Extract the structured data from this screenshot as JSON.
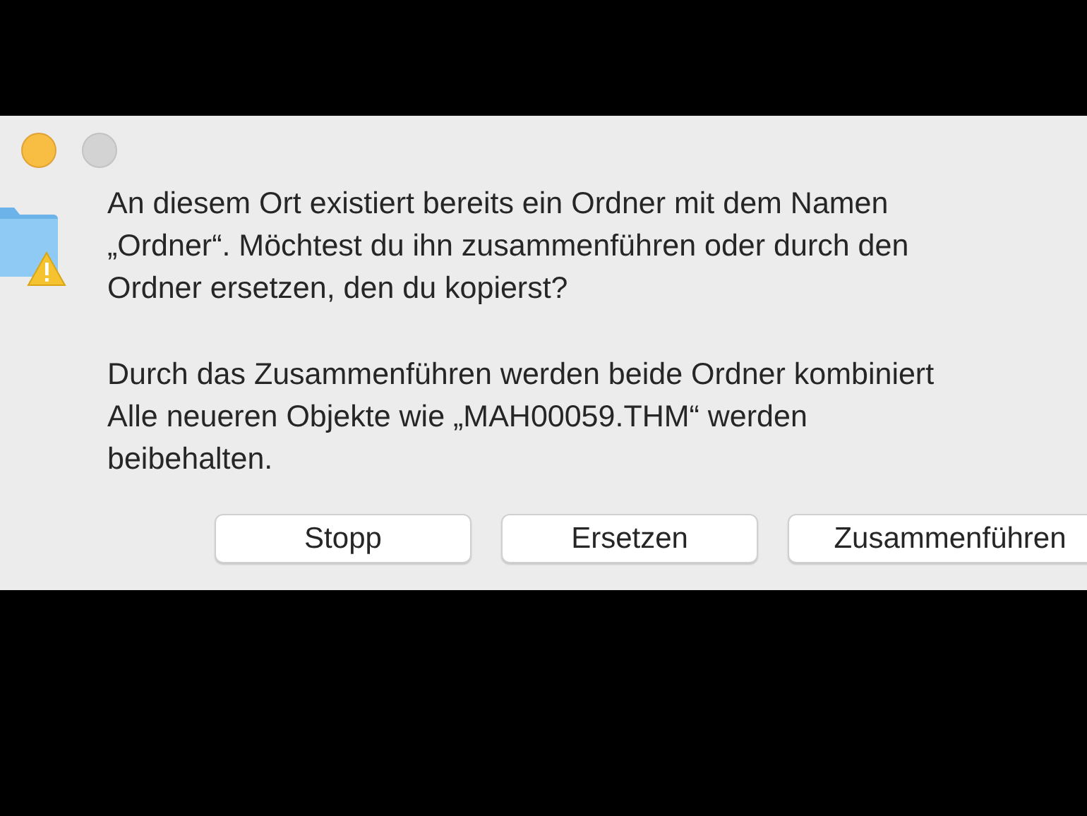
{
  "dialog": {
    "message": "An diesem Ort existiert bereits ein Ordner mit dem Namen\n„Ordner“. Möchtest du ihn zusammenführen oder durch den\nOrdner ersetzen, den du kopierst?",
    "detail": "Durch das Zusammenführen werden beide Ordner kombiniert\nAlle neueren Objekte wie „MAH00059.THM“ werden\nbeibehalten.",
    "buttons": [
      "Stopp",
      "Ersetzen",
      "Zusammenführen"
    ]
  }
}
